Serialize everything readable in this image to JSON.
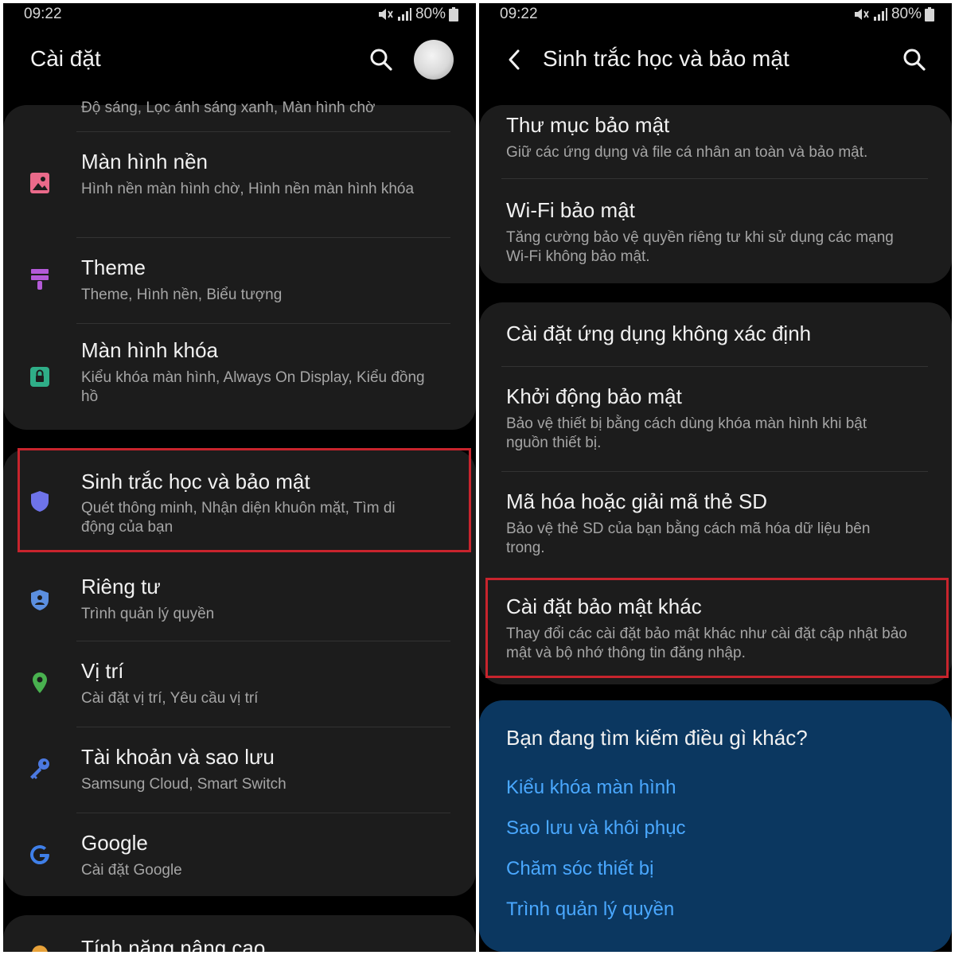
{
  "left": {
    "status": {
      "time": "09:22",
      "battery": "80%"
    },
    "appbar": {
      "title": "Cài đặt",
      "search_icon": "search-icon",
      "avatar": "profile-avatar"
    },
    "partial_top_subtitle": "Độ sáng, Lọc ánh sáng xanh, Màn hình chờ",
    "items": [
      {
        "title": "Màn hình nền",
        "subtitle": "Hình nền màn hình chờ, Hình nền màn hình khóa",
        "icon": "wallpaper-icon",
        "icon_color": "#ea6a8a"
      },
      {
        "title": "Theme",
        "subtitle": "Theme, Hình nền, Biểu tượng",
        "icon": "theme-brush-icon",
        "icon_color": "#b45ad8"
      },
      {
        "title": "Màn hình khóa",
        "subtitle": "Kiểu khóa màn hình, Always On Display, Kiểu đồng hồ",
        "icon": "lock-icon",
        "icon_color": "#2fae88"
      },
      {
        "title": "Sinh trắc học và bảo mật",
        "subtitle": "Quét thông minh, Nhận diện khuôn mặt, Tìm di động của bạn",
        "icon": "shield-icon",
        "icon_color": "#6e73ea"
      },
      {
        "title": "Riêng tư",
        "subtitle": "Trình quản lý quyền",
        "icon": "privacy-shield-icon",
        "icon_color": "#5b8fe0"
      },
      {
        "title": "Vị trí",
        "subtitle": "Cài đặt vị trí, Yêu cầu vị trí",
        "icon": "location-pin-icon",
        "icon_color": "#49b14f"
      },
      {
        "title": "Tài khoản và sao lưu",
        "subtitle": "Samsung Cloud, Smart Switch",
        "icon": "key-icon",
        "icon_color": "#4c79e0"
      },
      {
        "title": "Google",
        "subtitle": "Cài đặt Google",
        "icon": "google-icon",
        "icon_color": "#3f7fe8"
      }
    ],
    "partial_bottom_title": "Tính năng nâng cao"
  },
  "right": {
    "status": {
      "time": "09:22",
      "battery": "80%"
    },
    "appbar": {
      "title": "Sinh trắc học và bảo mật",
      "back_icon": "back-arrow-icon",
      "search_icon": "search-icon"
    },
    "group1": [
      {
        "title": "Thư mục bảo mật",
        "subtitle": "Giữ các ứng dụng và file cá nhân an toàn và bảo mật."
      },
      {
        "title": "Wi-Fi bảo mật",
        "subtitle": "Tăng cường bảo vệ quyền riêng tư khi sử dụng các mạng Wi-Fi không bảo mật."
      }
    ],
    "group2": [
      {
        "title": "Cài đặt ứng dụng không xác định",
        "subtitle": ""
      },
      {
        "title": "Khởi động bảo mật",
        "subtitle": "Bảo vệ thiết bị bằng cách dùng khóa màn hình khi bật nguồn thiết bị."
      },
      {
        "title": "Mã hóa hoặc giải mã thẻ SD",
        "subtitle": "Bảo vệ thẻ SD của bạn bằng cách mã hóa dữ liệu bên trong."
      },
      {
        "title": "Cài đặt bảo mật khác",
        "subtitle": "Thay đổi các cài đặt bảo mật khác như cài đặt cập nhật bảo mật và bộ nhớ thông tin đăng nhập."
      }
    ],
    "suggestions": {
      "title": "Bạn đang tìm kiếm điều gì khác?",
      "links": [
        "Kiểu khóa màn hình",
        "Sao lưu và khôi phục",
        "Chăm sóc thiết bị",
        "Trình quản lý quyền"
      ]
    }
  },
  "colors": {
    "highlight": "#c8242d",
    "link": "#4aa8ff",
    "card": "#1c1c1c",
    "suggestion_card": "#0b3760"
  }
}
